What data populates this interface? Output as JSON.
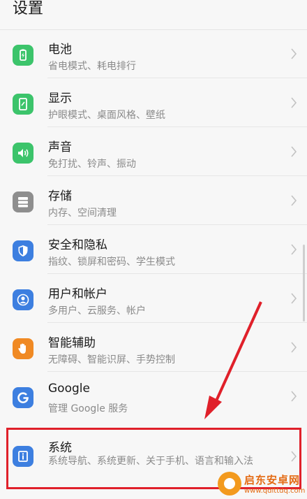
{
  "header": {
    "title": "设置"
  },
  "items": [
    {
      "key": "battery",
      "title": "电池",
      "subtitle": "省电模式、耗电排行",
      "icon": "battery-icon",
      "color": "#3cc46b"
    },
    {
      "key": "display",
      "title": "显示",
      "subtitle": "护眼模式、桌面风格、壁纸",
      "icon": "phone-icon",
      "color": "#3cc46b"
    },
    {
      "key": "sound",
      "title": "声音",
      "subtitle": "免打扰、铃声、振动",
      "icon": "speaker-icon",
      "color": "#3cc46b"
    },
    {
      "key": "storage",
      "title": "存储",
      "subtitle": "内存、空间清理",
      "icon": "storage-icon",
      "color": "#8e8e8e"
    },
    {
      "key": "security",
      "title": "安全和隐私",
      "subtitle": "指纹、锁屏和密码、学生模式",
      "icon": "shield-icon",
      "color": "#3d7fe0"
    },
    {
      "key": "accounts",
      "title": "用户和帐户",
      "subtitle": "多用户、云服务、帐户",
      "icon": "user-icon",
      "color": "#3d7fe0"
    },
    {
      "key": "assist",
      "title": "智能辅助",
      "subtitle": "无障碍、智能识屏、手势控制",
      "icon": "hand-icon",
      "color": "#f08a24"
    },
    {
      "key": "google",
      "title": "Google",
      "subtitle": "管理 Google 服务",
      "icon": "google-icon",
      "color": "#3d7fe0"
    },
    {
      "key": "system",
      "title": "系统",
      "subtitle": "系统导航、系统更新、关于手机、语言和输入法",
      "icon": "info-icon",
      "color": "#3d7fe0"
    }
  ],
  "watermark": {
    "name": "启东安卓网",
    "url": "www.qdlttdq.com"
  },
  "colors": {
    "highlight": "#e0202a",
    "background": "#f7f7f7"
  }
}
